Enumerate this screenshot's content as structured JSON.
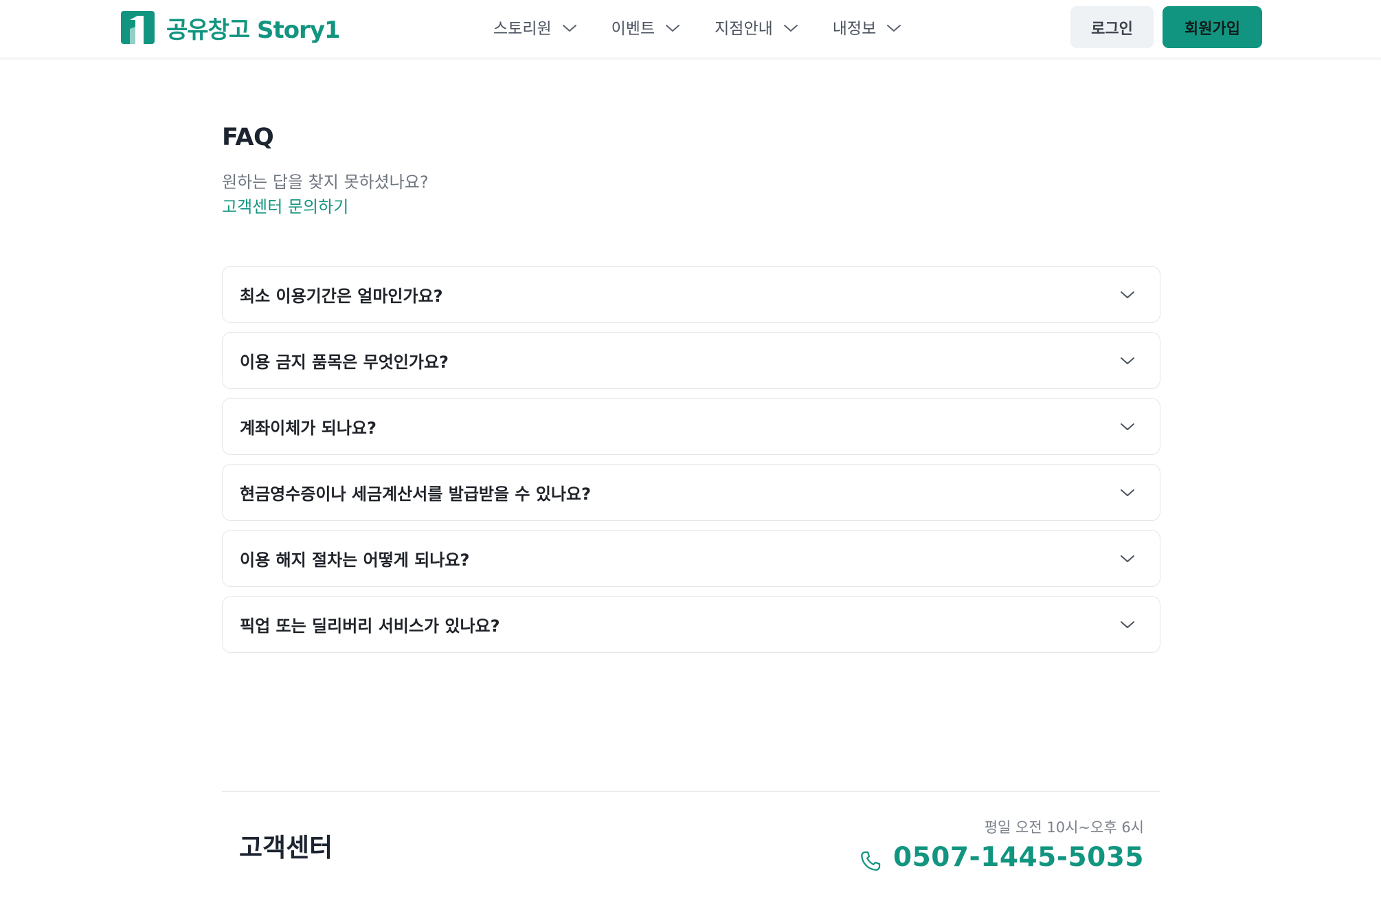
{
  "brand": {
    "name": "공유창고 Story1",
    "accent_color": "#129580"
  },
  "nav": {
    "items": [
      {
        "label": "스토리원",
        "icon": "chevron-down-icon"
      },
      {
        "label": "이벤트",
        "icon": "chevron-down-icon"
      },
      {
        "label": "지점안내",
        "icon": "chevron-down-icon"
      },
      {
        "label": "내정보",
        "icon": "chevron-down-icon"
      }
    ],
    "login_label": "로그인",
    "signup_label": "회원가입"
  },
  "faq": {
    "title": "FAQ",
    "subtitle": "원하는 답을 찾지 못하셨나요?",
    "contact_link": "고객센터 문의하기",
    "items": [
      {
        "question": "최소 이용기간은 얼마인가요?",
        "expanded": false
      },
      {
        "question": "이용 금지 품목은 무엇인가요?",
        "expanded": false
      },
      {
        "question": "계좌이체가 되나요?",
        "expanded": false
      },
      {
        "question": "현금영수증이나 세금계산서를 발급받을 수 있나요?",
        "expanded": false
      },
      {
        "question": "이용 해지 절차는 어떻게 되나요?",
        "expanded": false
      },
      {
        "question": "픽업 또는 딜리버리 서비스가 있나요?",
        "expanded": false
      }
    ]
  },
  "customer_center": {
    "title": "고객센터",
    "hours": "평일 오전 10시~오후 6시",
    "phone": "0507-1445-5035",
    "phone_icon": "phone-icon"
  }
}
